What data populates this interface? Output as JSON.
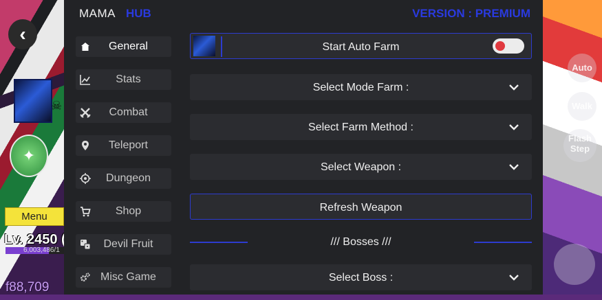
{
  "app": {
    "title": "MAMA",
    "hub": "HUB",
    "version": "VERSION : PREMIUM"
  },
  "sidebar": {
    "items": [
      {
        "label": "General",
        "icon": "home-icon",
        "active": true
      },
      {
        "label": "Stats",
        "icon": "chart-icon",
        "active": false
      },
      {
        "label": "Combat",
        "icon": "crossed-swords-icon",
        "active": false
      },
      {
        "label": "Teleport",
        "icon": "location-pin-icon",
        "active": false
      },
      {
        "label": "Dungeon",
        "icon": "target-icon",
        "active": false
      },
      {
        "label": "Shop",
        "icon": "cart-icon",
        "active": false
      },
      {
        "label": "Devil Fruit",
        "icon": "dice-icon",
        "active": false
      },
      {
        "label": "Misc Game",
        "icon": "gears-icon",
        "active": false
      }
    ]
  },
  "main": {
    "auto_farm": {
      "label": "Start Auto Farm",
      "toggle_on": false
    },
    "select_mode": {
      "label": "Select Mode Farm :"
    },
    "select_method": {
      "label": "Select Farm Method :"
    },
    "select_weapon": {
      "label": "Select Weapon :"
    },
    "refresh_weapon": {
      "label": "Refresh Weapon"
    },
    "bosses_section": {
      "label": "/// Bosses ///"
    },
    "select_boss": {
      "label": "Select Boss :"
    }
  },
  "game_hud": {
    "menu_label": "Menu",
    "level": "Lv. 2450 (",
    "xp_text": "6,003,486/1",
    "xp_fraction": 0.7,
    "money": "f88,709",
    "right_buttons": [
      "Auto",
      "Walk",
      "Flash Step"
    ]
  },
  "colors": {
    "accent": "#2a3adf",
    "panel": "#222326",
    "row": "#2b2c30",
    "toggle_knob": "#e0393f"
  }
}
